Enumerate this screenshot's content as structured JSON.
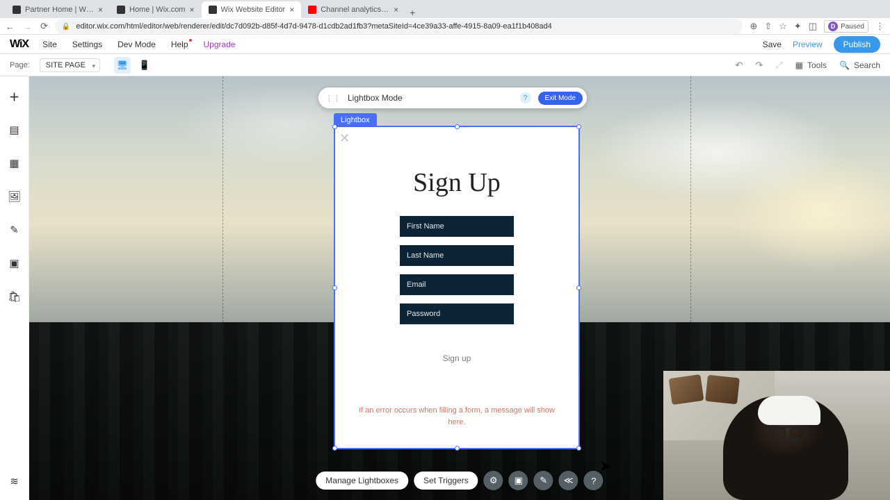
{
  "browser": {
    "tabs": [
      {
        "title": "Partner Home | Wix.com",
        "active": false,
        "favicon": "wix"
      },
      {
        "title": "Home | Wix.com",
        "active": false,
        "favicon": "wix"
      },
      {
        "title": "Wix Website Editor",
        "active": true,
        "favicon": "wix"
      },
      {
        "title": "Channel analytics - YouTube S",
        "active": false,
        "favicon": "yt"
      }
    ],
    "url": "editor.wix.com/html/editor/web/renderer/edit/dc7d092b-d85f-4d7d-9478-d1cdb2ad1fb3?metaSiteId=4ce39a33-affe-4915-8a09-ea1f1b408ad4",
    "profile_label": "Paused",
    "profile_initial": "D"
  },
  "wix": {
    "menu": {
      "site": "Site",
      "settings": "Settings",
      "dev": "Dev Mode",
      "help": "Help",
      "upgrade": "Upgrade"
    },
    "top_actions": {
      "save": "Save",
      "preview": "Preview",
      "publish": "Publish"
    },
    "second_bar": {
      "page_label": "Page:",
      "page_value": "SITE PAGE",
      "tools": "Tools",
      "search": "Search"
    }
  },
  "mode_bar": {
    "label": "Lightbox Mode",
    "exit": "Exit Mode"
  },
  "lightbox": {
    "selection_label": "Lightbox",
    "title": "Sign Up",
    "fields": {
      "first_name": "First Name",
      "last_name": "Last Name",
      "email": "Email",
      "password": "Password"
    },
    "submit": "Sign up",
    "error_hint": "If an error occurs when filling a form, a message will show here."
  },
  "actions": {
    "manage": "Manage Lightboxes",
    "triggers": "Set Triggers"
  }
}
